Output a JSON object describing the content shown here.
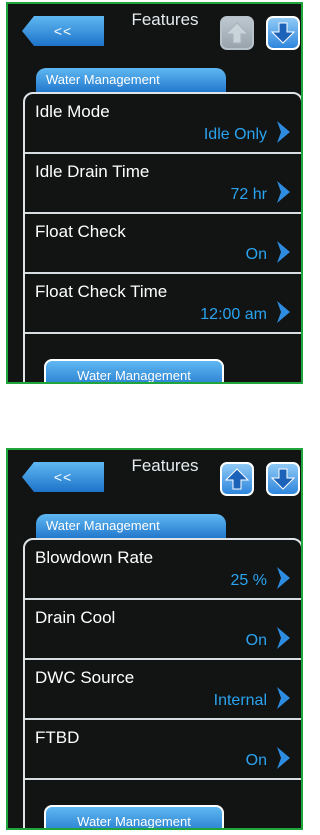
{
  "screens": [
    {
      "back_label": "<<",
      "title": "Features",
      "up_enabled": false,
      "down_enabled": true,
      "tab_label": "Water Management",
      "rows": [
        {
          "label": "Idle Mode",
          "value": "Idle Only"
        },
        {
          "label": "Idle Drain Time",
          "value": "72 hr"
        },
        {
          "label": "Float Check",
          "value": "On"
        },
        {
          "label": "Float Check Time",
          "value": "12:00 am"
        }
      ],
      "bottom_button": "Water Management"
    },
    {
      "back_label": "<<",
      "title": "Features",
      "up_enabled": true,
      "down_enabled": true,
      "tab_label": "Water Management",
      "rows": [
        {
          "label": "Blowdown Rate",
          "value": "25 %"
        },
        {
          "label": "Drain Cool",
          "value": "On"
        },
        {
          "label": "DWC Source",
          "value": "Internal"
        },
        {
          "label": "FTBD",
          "value": "On"
        }
      ],
      "bottom_button": "Water Management"
    }
  ],
  "icons": {
    "back": "double-chevron-left-icon",
    "up": "arrow-up-icon",
    "down": "arrow-down-icon",
    "row": "chevron-right-icon"
  },
  "colors": {
    "frame": "#1fa53c",
    "background": "#121413",
    "accent_blue": "#1e73c9",
    "value_text": "#2aa3f0"
  }
}
